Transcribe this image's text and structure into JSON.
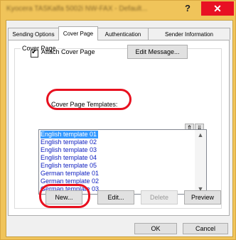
{
  "window": {
    "title": "Kyocera TASKalfa 5002i NW-FAX - Default...",
    "help_label": "?",
    "close_label": "✕"
  },
  "tabs": [
    {
      "label": "Sending Options",
      "active": false
    },
    {
      "label": "Cover Page",
      "active": true
    },
    {
      "label": "Authentication",
      "active": false
    },
    {
      "label": "Sender Information",
      "active": false
    }
  ],
  "cover_page": {
    "group_label": "Cover Page",
    "attach_label": "Attach Cover Page",
    "attach_checked": true,
    "check_mark": "✔",
    "edit_message_label": "Edit Message...",
    "templates_label": "Cover Page Templates:",
    "sort_up_label": "⇑",
    "sort_down_label": "⇓",
    "templates": [
      "English template 01",
      "English template 02",
      "English template 03",
      "English template 04",
      "English template 05",
      "German template 01",
      "German template 02",
      "German template 03"
    ],
    "selected_template_index": 0,
    "scroll_up_label": "▲",
    "scroll_down_label": "▼",
    "new_label": "New...",
    "edit_label": "Edit...",
    "delete_label": "Delete",
    "preview_label": "Preview"
  },
  "footer": {
    "ok_label": "OK",
    "cancel_label": "Cancel"
  },
  "colors": {
    "highlight": "#e8101f",
    "selection": "#3399ff",
    "close_button": "#e81123",
    "frame": "#f0c45a"
  }
}
